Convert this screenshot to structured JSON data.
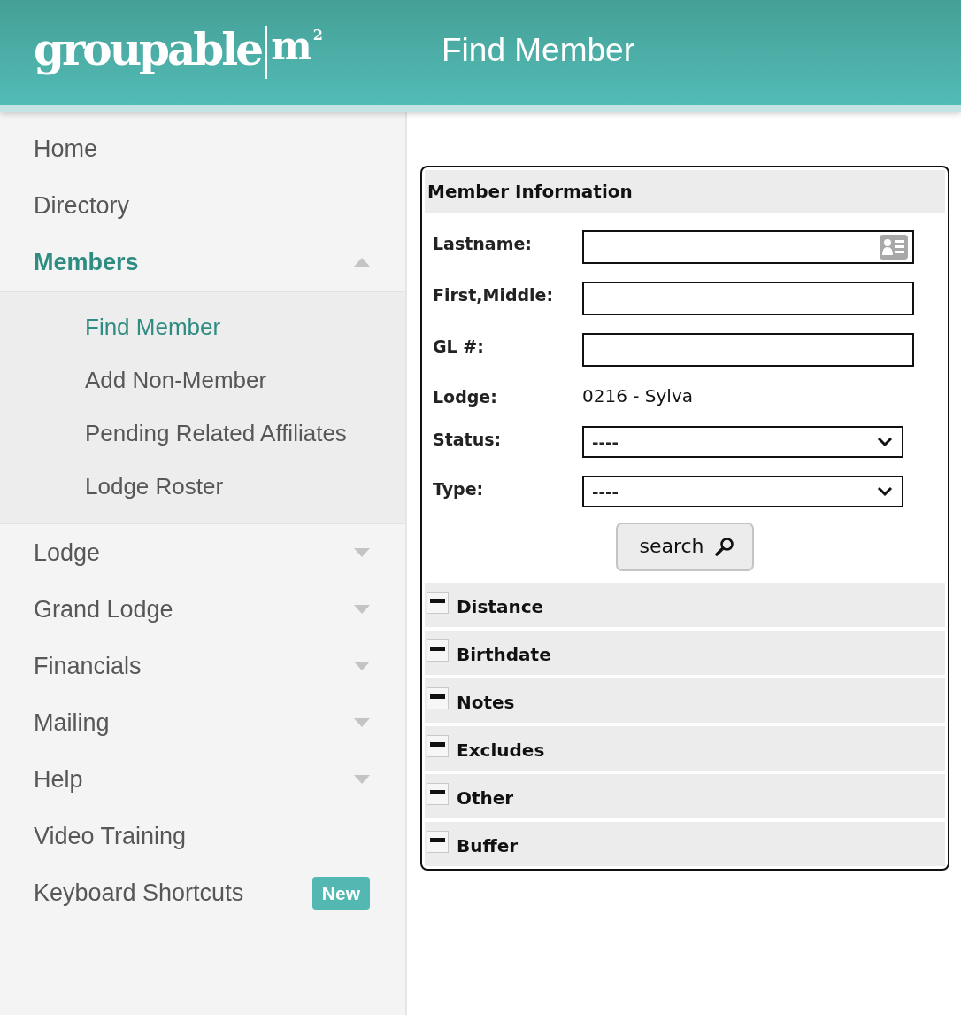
{
  "header": {
    "logo": {
      "name": "groupable",
      "mark": "m$^{2}$"
    },
    "title": "Find Member"
  },
  "sidebar": {
    "items": [
      {
        "kind": "link",
        "label": "Home",
        "selected": false
      },
      {
        "kind": "link",
        "label": "Directory",
        "selected": false
      },
      {
        "kind": "group",
        "label": "Members",
        "selected": true,
        "expanded": true,
        "children": [
          {
            "label": "Find Member",
            "selected": true
          },
          {
            "label": "Add Non-Member",
            "selected": false
          },
          {
            "label": "Pending Related Affiliates",
            "selected": false
          },
          {
            "label": "Lodge Roster",
            "selected": false
          }
        ]
      },
      {
        "kind": "group",
        "label": "Lodge",
        "selected": false,
        "expanded": false
      },
      {
        "kind": "group",
        "label": "Grand Lodge",
        "selected": false,
        "expanded": false
      },
      {
        "kind": "group",
        "label": "Financials",
        "selected": false,
        "expanded": false
      },
      {
        "kind": "group",
        "label": "Mailing",
        "selected": false,
        "expanded": false
      },
      {
        "kind": "group",
        "label": "Help",
        "selected": false,
        "expanded": false
      },
      {
        "kind": "link",
        "label": "Video Training",
        "selected": false
      },
      {
        "kind": "link",
        "label": "Keyboard Shortcuts",
        "selected": false,
        "badge": "New"
      }
    ]
  },
  "panel": {
    "title": "Member Information",
    "fields": [
      {
        "kind": "lookup",
        "label": "Lastname:"
      },
      {
        "kind": "text",
        "label": "First,Middle:"
      },
      {
        "kind": "text",
        "label": "GL #:"
      },
      {
        "kind": "static",
        "label": "Lodge:",
        "value": "0216 - Sylva"
      },
      {
        "kind": "select",
        "label": "Status:",
        "value": "----"
      },
      {
        "kind": "select",
        "label": "Type:",
        "value": "----"
      }
    ],
    "search_button": "search",
    "sections": [
      {
        "label": "Distance",
        "expanded": true
      },
      {
        "label": "Birthdate",
        "expanded": true
      },
      {
        "label": "Notes",
        "expanded": true
      },
      {
        "label": "Excludes",
        "expanded": true
      },
      {
        "label": "Other",
        "expanded": true
      },
      {
        "label": "Buffer",
        "expanded": true
      }
    ]
  }
}
